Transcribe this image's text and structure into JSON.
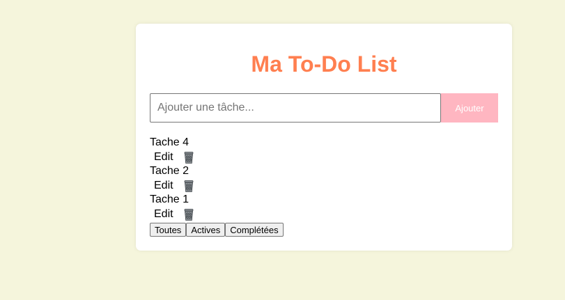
{
  "app": {
    "title": "Ma To-Do List",
    "title_color": "#ff7f50",
    "background_color": "#f5f5dc"
  },
  "new_task": {
    "placeholder": "Ajouter une tâche...",
    "value": "",
    "add_label": "Ajouter",
    "add_color": "#ffb6c1"
  },
  "tasks": [
    {
      "text": "Tache 4",
      "edit_label": "Edit",
      "delete_icon": "trash-icon"
    },
    {
      "text": "Tache 2",
      "edit_label": "Edit",
      "delete_icon": "trash-icon"
    },
    {
      "text": "Tache 1",
      "edit_label": "Edit",
      "delete_icon": "trash-icon"
    }
  ],
  "filters": {
    "all_label": "Toutes",
    "active_label": "Actives",
    "completed_label": "Complétées"
  }
}
